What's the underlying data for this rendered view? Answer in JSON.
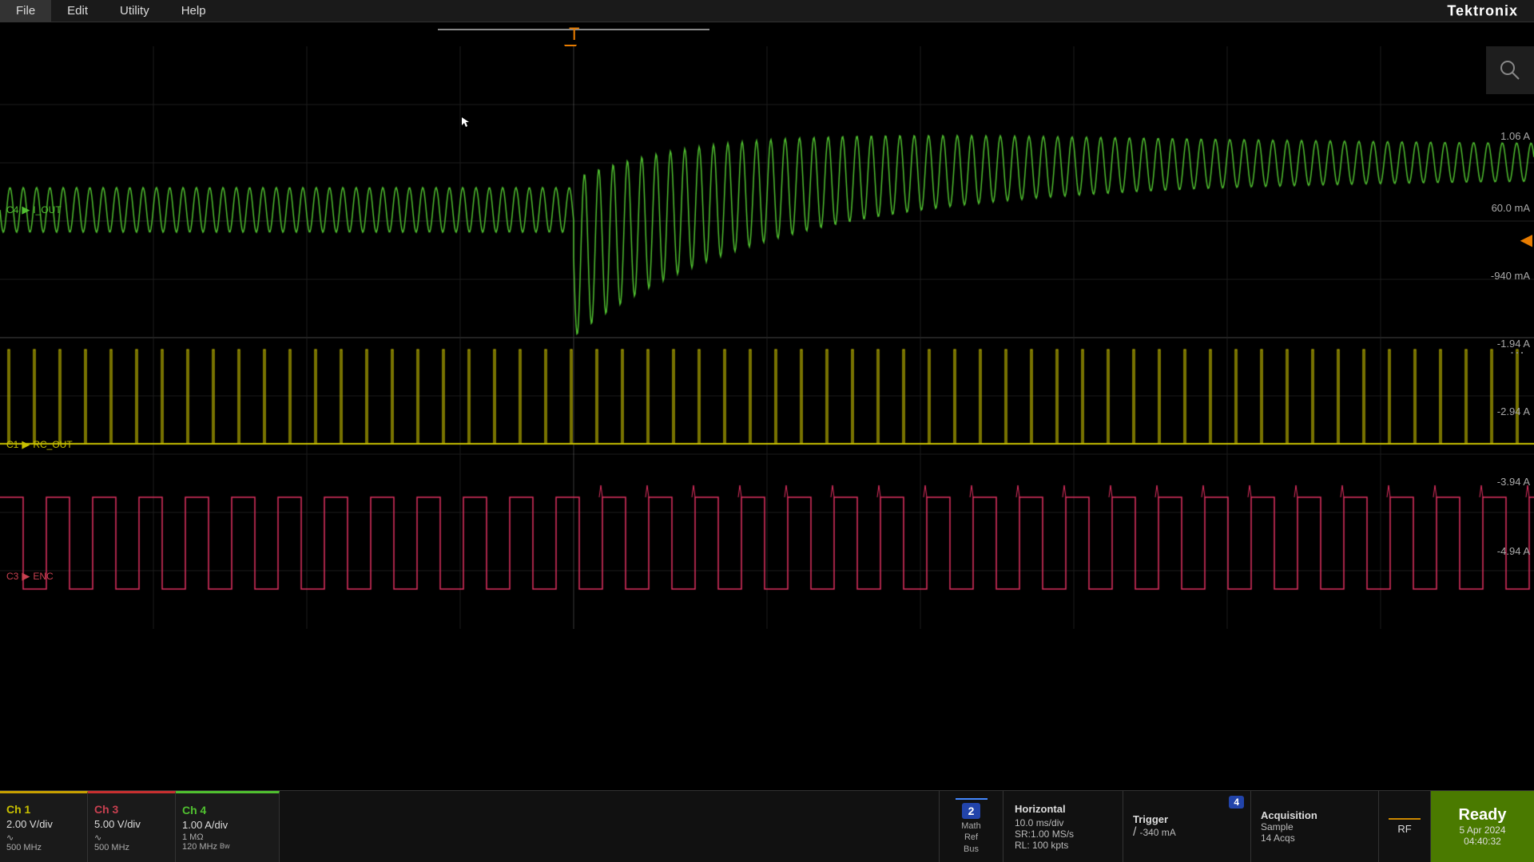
{
  "menu": {
    "items": [
      "File",
      "Edit",
      "Utility",
      "Help"
    ],
    "logo": "Tektronix"
  },
  "channels": {
    "ch1": {
      "label": "Ch 1",
      "color": "#c8c000",
      "bgColor": "#1a1a1a",
      "borderColor": "#c8a000",
      "vdiv": "2.00 V/div",
      "icon": "∿",
      "bandwidth": "500 MHz",
      "signal": "RC_OUT"
    },
    "ch3": {
      "label": "Ch 3",
      "color": "#c84050",
      "bgColor": "#1a1a1a",
      "borderColor": "#c83030",
      "vdiv": "5.00 V/div",
      "icon": "∿",
      "bandwidth": "500 MHz",
      "signal": "ENC"
    },
    "ch4": {
      "label": "Ch 4",
      "color": "#50c030",
      "bgColor": "#1a1a1a",
      "borderColor": "#50c030",
      "vdiv": "1.00 A/div",
      "impedance": "1 MΩ",
      "bandwidth": "120 MHz",
      "bw_suffix": "Bw",
      "signal": "I_OUT"
    }
  },
  "y_labels": {
    "l1": "1.06 A",
    "l2": "60.0 mA",
    "l3": "-940 mA",
    "l4": "-1.94 A",
    "l5": "-2.94 A",
    "l6": "-3.94 A",
    "l7": "-4.94 A"
  },
  "math_ref_bus": {
    "line_color": "#4488ff",
    "number": "2",
    "label": "Math\nRef\nBus"
  },
  "horizontal": {
    "title": "Horizontal",
    "time_div": "10.0 ms/div",
    "sample_rate": "SR:1.00 MS/s",
    "record_length": "RL: 100 kpts"
  },
  "trigger": {
    "title": "Trigger",
    "channel_badge": "4",
    "slope": "/",
    "level": "-340 mA"
  },
  "acquisition": {
    "title": "Acquisition",
    "mode": "Sample",
    "acqs": "14 Acqs"
  },
  "rf": {
    "label": "RF"
  },
  "ready": {
    "label": "Ready",
    "date": "5 Apr 2024",
    "time": "04:40:32"
  }
}
